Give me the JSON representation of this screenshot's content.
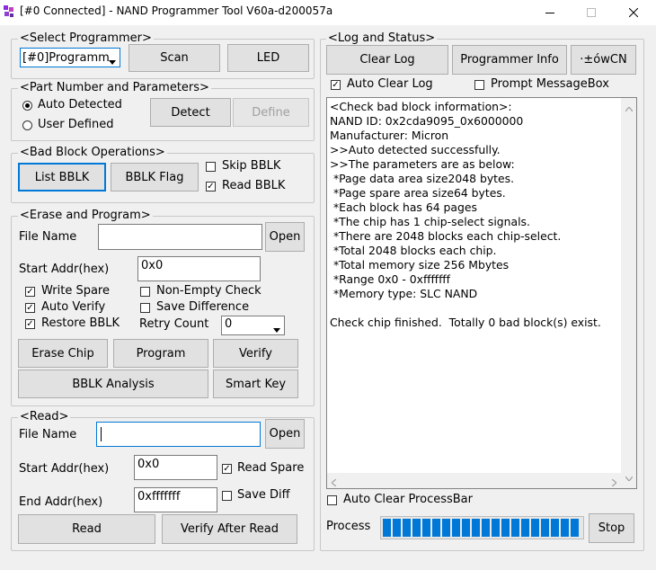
{
  "window": {
    "title": "[#0 Connected]  - NAND Programmer Tool V60a-d200057a"
  },
  "select_programmer": {
    "label": "<Select Programmer>",
    "programmer_value": "[#0]Programm",
    "scan": "Scan",
    "led": "LED"
  },
  "part": {
    "label": "<Part Number and Parameters>",
    "auto_detected": "Auto Detected",
    "user_defined": "User Defined",
    "detect": "Detect",
    "define": "Define"
  },
  "bad_block": {
    "label": "<Bad Block Operations>",
    "list_bblk": "List BBLK",
    "bblk_flag": "BBLK Flag",
    "skip_bblk": "Skip BBLK",
    "read_bblk": "Read BBLK"
  },
  "erase_program": {
    "label": "<Erase and Program>",
    "file_name_label": "File Name",
    "file_name_value": "",
    "open": "Open",
    "start_addr_label": "Start Addr(hex)",
    "start_addr_value": "0x0",
    "write_spare": "Write Spare",
    "non_empty_check": "Non-Empty Check",
    "auto_verify": "Auto Verify",
    "save_difference": "Save Difference",
    "restore_bblk": "Restore BBLK",
    "retry_count_label": "Retry Count",
    "retry_count_value": "0",
    "erase_chip": "Erase Chip",
    "program": "Program",
    "verify": "Verify",
    "bblk_analysis": "BBLK Analysis",
    "smart_key": "Smart Key"
  },
  "read": {
    "label": "<Read>",
    "file_name_label": "File Name",
    "file_name_value": "",
    "open": "Open",
    "start_addr_label": "Start Addr(hex)",
    "start_addr_value": "0x0",
    "read_spare": "Read Spare",
    "end_addr_label": "End Addr(hex)",
    "end_addr_value": "0xfffffff",
    "save_diff": "Save Diff",
    "read": "Read",
    "verify_after_read": "Verify After Read"
  },
  "log": {
    "label": "<Log and Status>",
    "clear_log": "Clear Log",
    "programmer_info": "Programmer Info",
    "lang_button": "·±ówCN",
    "auto_clear_log": "Auto Clear Log",
    "prompt_messagebox": "Prompt MessageBox",
    "lines": [
      "<Check bad block information>:",
      "NAND ID: 0x2cda9095_0x6000000",
      "Manufacturer: Micron",
      ">>Auto detected successfully.",
      ">>The parameters are as below:",
      " *Page data area size2048 bytes.",
      " *Page spare area size64 bytes.",
      " *Each block has 64 pages",
      " *The chip has 1 chip-select signals.",
      " *There are 2048 blocks each chip-select.",
      " *Total 2048 blocks each chip.",
      " *Total memory size 256 Mbytes",
      " *Range 0x0 - 0xfffffff",
      " *Memory type: SLC NAND",
      "",
      "Check chip finished.  Totally 0 bad block(s) exist."
    ],
    "auto_clear_processbar": "Auto Clear ProcessBar",
    "process_label": "Process",
    "progress_fraction": 1.0,
    "stop": "Stop"
  },
  "icons": {
    "minimize": "minimize-icon",
    "maximize": "maximize-icon",
    "close": "close-icon"
  },
  "colors": {
    "progress": "#0078d7",
    "accent": "#0078d7"
  }
}
